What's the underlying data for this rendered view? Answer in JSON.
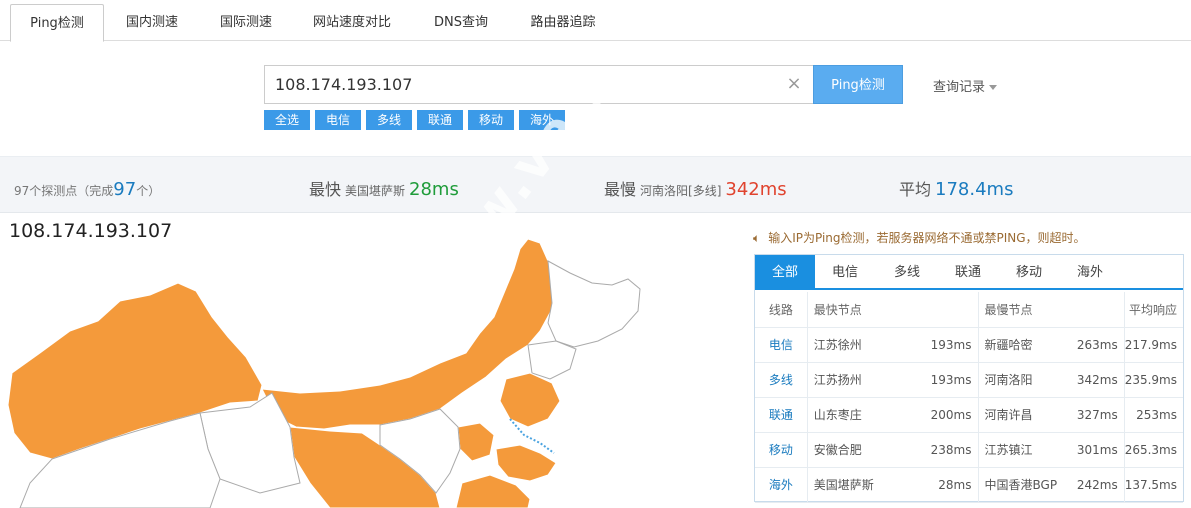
{
  "tabs": [
    {
      "label": "Ping检测",
      "active": true
    },
    {
      "label": "国内测速"
    },
    {
      "label": "国际测速"
    },
    {
      "label": "网站速度对比"
    },
    {
      "label": "DNS查询"
    },
    {
      "label": "路由器追踪"
    }
  ],
  "search": {
    "value": "108.174.193.107",
    "clear_glyph": "×",
    "button_label": "Ping检测",
    "history_label": "查询记录"
  },
  "filters": [
    "全选",
    "电信",
    "多线",
    "联通",
    "移动",
    "海外"
  ],
  "stats": {
    "count_prefix": "97个探测点（完成",
    "count_done": "97",
    "count_suffix": "个）",
    "fastest_label": "最快",
    "fastest_node": "美国堪萨斯",
    "fastest_value": "28ms",
    "slowest_label": "最慢",
    "slowest_node": "河南洛阳[多线]",
    "slowest_value": "342ms",
    "average_label": "平均",
    "average_value": "178.4ms"
  },
  "map": {
    "ip": "108.174.193.107",
    "watermark": "www.ve..."
  },
  "notice": {
    "icon": "speaker-icon",
    "text": "输入IP为Ping检测，若服务器网络不通或禁PING，则超时。"
  },
  "results": {
    "tabs": [
      "全部",
      "电信",
      "多线",
      "联通",
      "移动",
      "海外"
    ],
    "headers": {
      "line": "线路",
      "fastest": "最快节点",
      "slowest": "最慢节点",
      "average": "平均响应"
    },
    "rows": [
      {
        "line": "电信",
        "fast_node": "江苏徐州",
        "fast_ms": "193ms",
        "slow_node": "新疆哈密",
        "slow_ms": "263ms",
        "avg": "217.9ms"
      },
      {
        "line": "多线",
        "fast_node": "江苏扬州",
        "fast_ms": "193ms",
        "slow_node": "河南洛阳",
        "slow_ms": "342ms",
        "avg": "235.9ms"
      },
      {
        "line": "联通",
        "fast_node": "山东枣庄",
        "fast_ms": "200ms",
        "slow_node": "河南许昌",
        "slow_ms": "327ms",
        "avg": "253ms"
      },
      {
        "line": "移动",
        "fast_node": "安徽合肥",
        "fast_ms": "238ms",
        "slow_node": "江苏镇江",
        "slow_ms": "301ms",
        "avg": "265.3ms"
      },
      {
        "line": "海外",
        "fast_node": "美国堪萨斯",
        "fast_ms": "28ms",
        "slow_node": "中国香港BGP",
        "slow_ms": "242ms",
        "avg": "137.5ms"
      }
    ]
  },
  "colors": {
    "accent": "#1a8fe0",
    "button": "#5aacf0",
    "filter": "#3b9ae8",
    "map_fill": "#f49a3b",
    "fastest": "#1f9c3a",
    "slowest": "#e0432e",
    "average": "#1a7bbf"
  }
}
